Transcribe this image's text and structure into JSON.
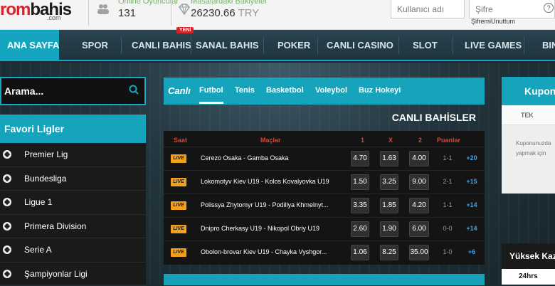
{
  "header": {
    "logo_red": "rom",
    "logo_black": "bahis",
    "logo_sub": ".com",
    "online_label": "Online Oyuncular",
    "online_value": "131",
    "balance_label": "Masalardaki Bakiyeler",
    "balance_value": "26230.66",
    "balance_unit": "TRY",
    "username_placeholder": "Kullanıcı adı",
    "password_placeholder": "Şifre",
    "help_glyph": "?",
    "forgot_password": "ŞifremiUnuttum"
  },
  "nav": {
    "items": [
      {
        "label": "ANA SAYFA"
      },
      {
        "label": "SPOR"
      },
      {
        "label": "CANLI BAHIS"
      },
      {
        "label": "SANAL BAHIS"
      },
      {
        "label": "POKER"
      },
      {
        "label": "CANLI CASINO"
      },
      {
        "label": "SLOT"
      },
      {
        "label": "LIVE GAMES"
      },
      {
        "label": "BIN"
      }
    ],
    "new_badge": "YENİ"
  },
  "sidebar": {
    "search_placeholder": "Arama...",
    "leagues_title": "Favori Ligler",
    "leagues": [
      {
        "label": "Premier Lig"
      },
      {
        "label": "Bundesliga"
      },
      {
        "label": "Ligue 1"
      },
      {
        "label": "Primera Division"
      },
      {
        "label": "Serie A"
      },
      {
        "label": "Şampiyonlar Ligi"
      }
    ]
  },
  "live": {
    "brand_label": "Canlı",
    "tabs": [
      {
        "label": "Futbol"
      },
      {
        "label": "Tenis"
      },
      {
        "label": "Basketbol"
      },
      {
        "label": "Voleybol"
      },
      {
        "label": "Buz Hokeyi"
      }
    ],
    "title": "CANLI BAHİSLER",
    "columns": {
      "time": "Saat",
      "matches": "Maçlar",
      "home": "1",
      "draw": "X",
      "away": "2",
      "points": "Puanlar"
    },
    "live_badge": "LIVE",
    "matches": [
      {
        "name": "Cerezo Osaka - Gamba Osaka",
        "odd1": "4.70",
        "oddx": "1.63",
        "odd2": "4.00",
        "score": "1-1",
        "more": "+20"
      },
      {
        "name": "Lokomotyv Kiev U19 - Kolos Kovalyovka U19",
        "odd1": "1.50",
        "oddx": "3.25",
        "odd2": "9.00",
        "score": "2-1",
        "more": "+15"
      },
      {
        "name": "Polissya Zhytomyr U19 - Podillya Khmelnyt...",
        "odd1": "3.35",
        "oddx": "1.85",
        "odd2": "4.20",
        "score": "1-1",
        "more": "+14"
      },
      {
        "name": "Dnipro Cherkasy U19 - Nikopol Obriy U19",
        "odd1": "2.60",
        "oddx": "1.90",
        "odd2": "6.00",
        "score": "0-0",
        "more": "+14"
      },
      {
        "name": "Obolon-brovar Kiev U19 - Chayka Vyshgor...",
        "odd1": "1.06",
        "oddx": "8.25",
        "odd2": "35.00",
        "score": "1-0",
        "more": "+6"
      }
    ]
  },
  "coupon": {
    "title": "Kuponum",
    "tab": "TEK",
    "empty_line1": "Kuponunuzda",
    "empty_line2": "yapmak için",
    "high_title": "Yüksek Kazanç",
    "high_sub": "24hrs"
  },
  "colors": {
    "accent": "#16a3bc",
    "brand_red": "#d5232a",
    "live_badge": "#f0a21f",
    "more_blue": "#3ea3e8"
  }
}
